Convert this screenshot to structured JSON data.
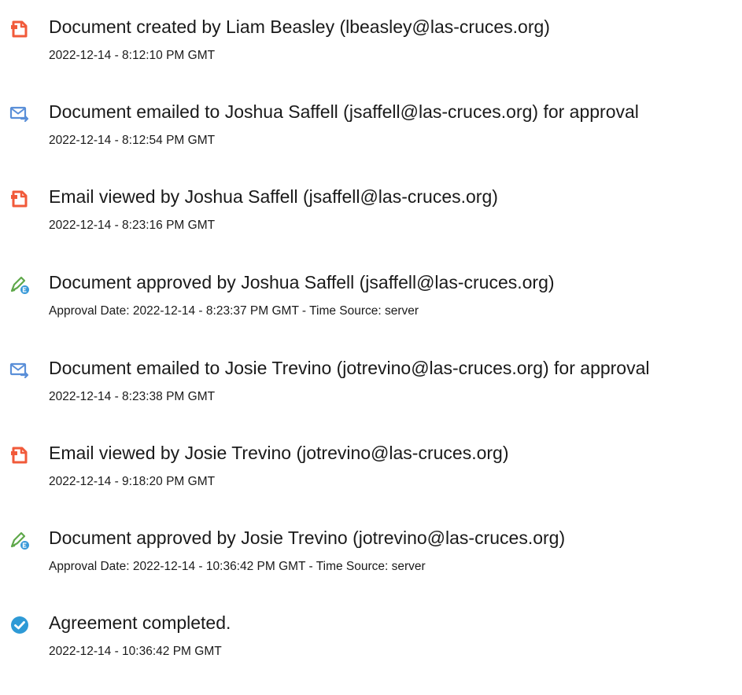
{
  "events": [
    {
      "icon": "pdf-document-icon",
      "title": "Document created by Liam Beasley (lbeasley@las-cruces.org)",
      "detail": "2022-12-14 - 8:12:10 PM GMT"
    },
    {
      "icon": "email-sent-icon",
      "title": "Document emailed to Joshua Saffell (jsaffell@las-cruces.org) for approval",
      "detail": "2022-12-14 - 8:12:54 PM GMT"
    },
    {
      "icon": "pdf-document-icon",
      "title": "Email viewed by Joshua Saffell (jsaffell@las-cruces.org)",
      "detail": "2022-12-14 - 8:23:16 PM GMT"
    },
    {
      "icon": "approval-pen-icon",
      "title": "Document approved by Joshua Saffell (jsaffell@las-cruces.org)",
      "detail": "Approval Date: 2022-12-14 - 8:23:37 PM GMT - Time Source: server"
    },
    {
      "icon": "email-sent-icon",
      "title": "Document emailed to Josie Trevino (jotrevino@las-cruces.org) for approval",
      "detail": "2022-12-14 - 8:23:38 PM GMT"
    },
    {
      "icon": "pdf-document-icon",
      "title": "Email viewed by Josie Trevino (jotrevino@las-cruces.org)",
      "detail": "2022-12-14 - 9:18:20 PM GMT"
    },
    {
      "icon": "approval-pen-icon",
      "title": "Document approved by Josie Trevino (jotrevino@las-cruces.org)",
      "detail": "Approval Date: 2022-12-14 - 10:36:42 PM GMT - Time Source: server"
    },
    {
      "icon": "checkmark-circle-icon",
      "title": "Agreement completed.",
      "detail": "2022-12-14 - 10:36:42 PM GMT"
    }
  ],
  "colors": {
    "pdf_icon": "#f15a3a",
    "email_icon": "#5a8fd8",
    "approval_pen": "#5fa84a",
    "approval_badge": "#3a9ad9",
    "check_circle": "#2e9ad6",
    "text": "#1a1a1a"
  }
}
